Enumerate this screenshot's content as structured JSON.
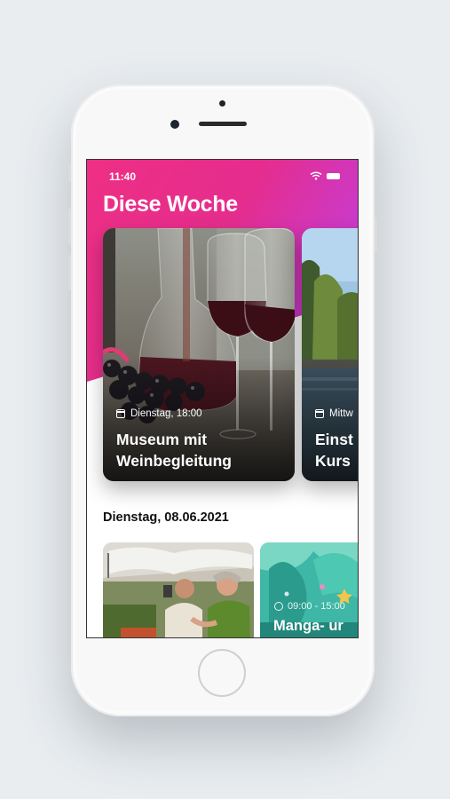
{
  "status_bar": {
    "time": "11:40"
  },
  "header": {
    "title": "Diese Woche"
  },
  "featured_events": [
    {
      "date_time": "Dienstag, 18:00",
      "title": "Museum mit Weinbegleitung"
    },
    {
      "date_time": "Mittw",
      "title": "Einst\nKurs"
    }
  ],
  "section": {
    "date": "Dienstag, 08.06.2021"
  },
  "day_events": [
    {
      "time": "",
      "title": ""
    },
    {
      "time": "09:00 - 15:00",
      "title": "Manga- ur"
    }
  ],
  "colors": {
    "accent_start": "#ee2f84",
    "accent_end": "#b94ad8"
  }
}
